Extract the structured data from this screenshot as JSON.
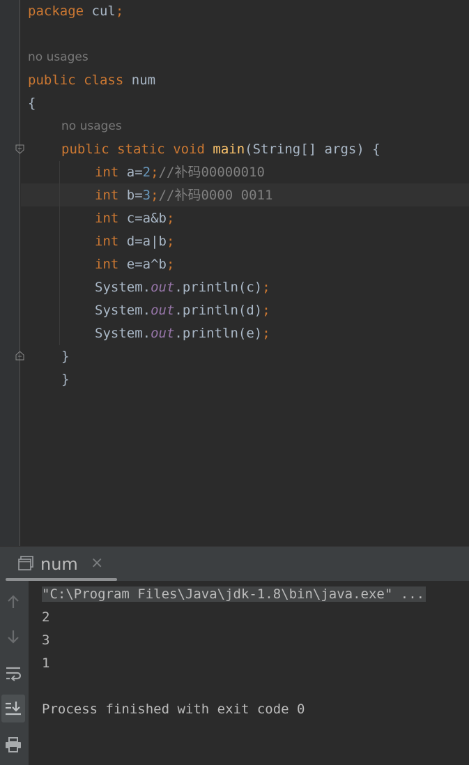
{
  "editor": {
    "package_kw": "package",
    "package_name": "cul",
    "semicolon": ";",
    "usages_hint_class": "no usages",
    "public_kw": "public",
    "class_kw": "class",
    "class_name": "num",
    "open_brace": "{",
    "usages_hint_main": "no usages",
    "static_kw": "static",
    "void_kw": "void",
    "main_name": "main",
    "main_params": "(String[] args) {",
    "int_kw": "int",
    "a_decl": "a=",
    "a_val": "2",
    "a_comment": "//补码00000010",
    "b_decl": "b=",
    "b_val": "3",
    "b_comment": "//补码0000 0011",
    "c_expr": "c=a&b",
    "d_expr": "d=a|b",
    "e_expr": "e=a^b",
    "system": "System.",
    "out": "out",
    "println_c": ".println(c)",
    "println_d": ".println(d)",
    "println_e": ".println(e)",
    "close_brace": "}"
  },
  "run_panel": {
    "tab_label": "num",
    "tab_close": "×",
    "command": "\"C:\\Program Files\\Java\\jdk-1.8\\bin\\java.exe\" ...",
    "output": [
      "2",
      "3",
      "1"
    ],
    "exit_message": "Process finished with exit code 0",
    "side_icons": [
      "arrow-up-icon",
      "arrow-down-icon",
      "soft-wrap-icon",
      "scroll-to-end-icon",
      "print-icon"
    ]
  },
  "colors": {
    "background": "#2b2b2b",
    "keyword": "#cc7832",
    "number": "#6897bb",
    "comment": "#808080",
    "field": "#9876aa",
    "method": "#ffc66d",
    "text": "#a9b7c6"
  }
}
